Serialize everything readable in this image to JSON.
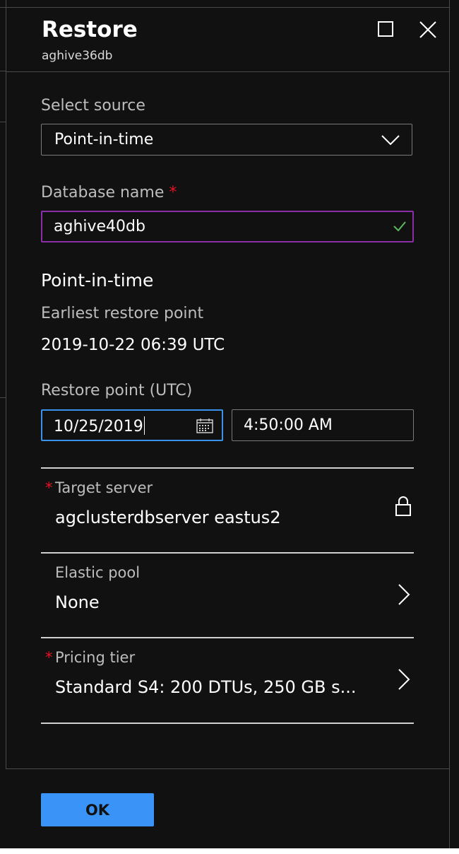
{
  "header": {
    "title": "Restore",
    "subtitle": "aghive36db"
  },
  "form": {
    "source_label": "Select source",
    "source_value": "Point-in-time",
    "db_name_label": "Database name",
    "required_mark": "*",
    "db_name_value": "aghive40db",
    "section_title": "Point-in-time",
    "earliest_label": "Earliest restore point",
    "earliest_value": "2019-10-22 06:39 UTC",
    "restore_point_label": "Restore point (UTC)",
    "restore_date": "10/25/2019",
    "restore_time": "4:50:00 AM"
  },
  "rows": [
    {
      "label": "Target server",
      "value": "agclusterdbserver eastus2",
      "required": true,
      "icon": "lock-icon"
    },
    {
      "label": "Elastic pool",
      "value": "None",
      "required": false,
      "icon": "chevron-right-icon"
    },
    {
      "label": "Pricing tier",
      "value": "Standard S4: 200 DTUs, 250 GB s...",
      "required": true,
      "icon": "chevron-right-icon"
    }
  ],
  "footer": {
    "ok_label": "OK"
  },
  "colors": {
    "background": "#111111",
    "accent": "#3a93f6",
    "required": "#e81123",
    "valid_input_border": "#8a2fa8",
    "focus_border": "#3a93e8",
    "valid_check": "#5cb85c"
  }
}
